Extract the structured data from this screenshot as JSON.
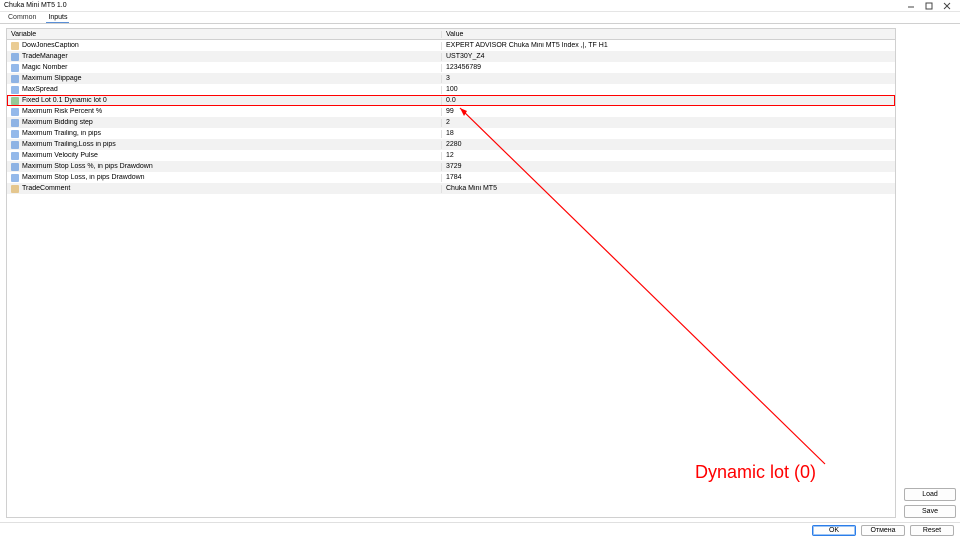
{
  "window": {
    "title": "Chuka Mini MT5 1.0"
  },
  "tabs": {
    "common": "Common",
    "inputs": "Inputs",
    "active": "inputs"
  },
  "grid": {
    "header_variable": "Variable",
    "header_value": "Value",
    "rows": [
      {
        "icon": "text-icon",
        "icon_color": "#d9a33c",
        "name": "DowJonesCaption",
        "value": "EXPERT ADVISOR Chuka Mini MT5 Index ,|, TF H1"
      },
      {
        "icon": "text-icon",
        "icon_color": "#3c7fd9",
        "name": "TradeManager",
        "value": "UST30Y_Z4"
      },
      {
        "icon": "int-icon",
        "icon_color": "#3c7fd9",
        "name": "Magic Nomber",
        "value": "123456789"
      },
      {
        "icon": "int-icon",
        "icon_color": "#3c7fd9",
        "name": "Maximum Slippage",
        "value": "3"
      },
      {
        "icon": "int-icon",
        "icon_color": "#3c7fd9",
        "name": "MaxSpread",
        "value": "100"
      },
      {
        "icon": "float-icon",
        "icon_color": "#49a84c",
        "name": "Fixed Lot 0.1 Dynamic lot 0",
        "value": "0.0",
        "highlight": true
      },
      {
        "icon": "int-icon",
        "icon_color": "#3c7fd9",
        "name": "Maximum Risk Percent %",
        "value": "99"
      },
      {
        "icon": "int-icon",
        "icon_color": "#3c7fd9",
        "name": "Maximum Bidding step",
        "value": "2"
      },
      {
        "icon": "int-icon",
        "icon_color": "#3c7fd9",
        "name": "Maximum Trailing, in pips",
        "value": "18"
      },
      {
        "icon": "int-icon",
        "icon_color": "#3c7fd9",
        "name": "Maximum Trailing,Loss in pips",
        "value": "2280"
      },
      {
        "icon": "int-icon",
        "icon_color": "#3c7fd9",
        "name": "Maximum Velocity Pulse",
        "value": "12"
      },
      {
        "icon": "int-icon",
        "icon_color": "#3c7fd9",
        "name": "Maximum Stop Loss %, in pips Drawdown",
        "value": "3729"
      },
      {
        "icon": "int-icon",
        "icon_color": "#3c7fd9",
        "name": "Maximum Stop Loss, in pips Drawdown",
        "value": "1784"
      },
      {
        "icon": "text-icon",
        "icon_color": "#d9a33c",
        "name": "TradeComment",
        "value": "Chuka Mini MT5"
      }
    ]
  },
  "side_buttons": {
    "load": "Load",
    "save": "Save"
  },
  "footer_buttons": {
    "ok": "OK",
    "cancel": "Отмена",
    "reset": "Reset"
  },
  "annotation": {
    "text": "Dynamic lot (0)"
  }
}
